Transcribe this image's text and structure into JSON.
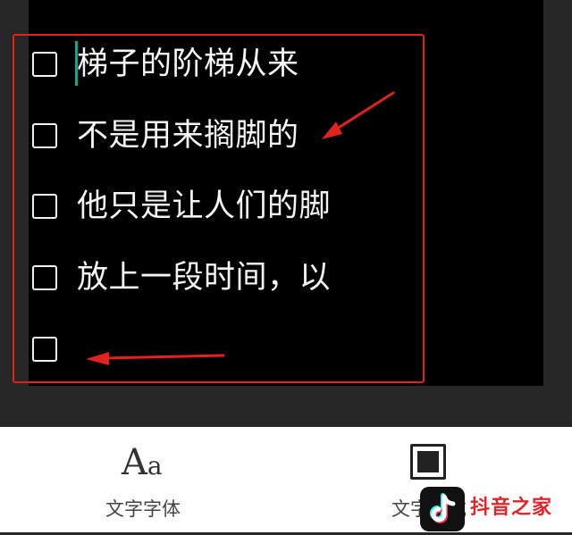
{
  "editor": {
    "items": [
      {
        "text": "梯子的阶梯从来",
        "checked": false
      },
      {
        "text": "不是用来搁脚的",
        "checked": false
      },
      {
        "text": "他只是让人们的脚",
        "checked": false
      },
      {
        "text": "放上一段时间，以",
        "checked": false
      },
      {
        "text": "",
        "checked": false
      }
    ]
  },
  "toolbar": {
    "font_label": "文字字体",
    "style_label": "文字样式"
  },
  "colors": {
    "canvas_bg": "#000000",
    "panel_bg": "#272727",
    "annotation_red": "#e0231f",
    "cursor": "#12a38f"
  },
  "icons": {
    "font": "aa-font-icon",
    "style": "square-style-icon"
  },
  "watermark": {
    "brand": "抖音之家"
  }
}
